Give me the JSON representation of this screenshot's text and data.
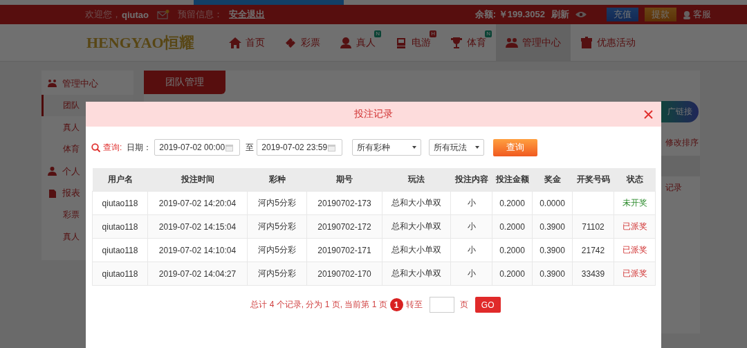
{
  "top_bar": {
    "welcome": "欢迎您，",
    "username": "qiutao",
    "reserved_label": "预留信息：",
    "logout": "安全退出",
    "balance": "余额: ￥199.3052",
    "refresh": "刷新",
    "deposit": "充值",
    "withdraw": "提款",
    "service": "客服"
  },
  "logo": "HENGYAO恒耀",
  "nav": [
    {
      "label": "首页",
      "selected": false
    },
    {
      "label": "彩票",
      "selected": false
    },
    {
      "label": "真人",
      "badge": "N",
      "selected": false
    },
    {
      "label": "电游",
      "badge": "H",
      "selected": false
    },
    {
      "label": "体育",
      "badge": "N",
      "selected": false
    },
    {
      "label": "管理中心",
      "selected": true
    },
    {
      "label": "优惠活动",
      "selected": false
    }
  ],
  "sidebar": [
    {
      "label": "管理中心",
      "kind": "header",
      "selected": false
    },
    {
      "label": "团队",
      "kind": "item",
      "selected": true
    },
    {
      "label": "真人",
      "kind": "item",
      "selected": false
    },
    {
      "label": "体育",
      "kind": "item",
      "selected": false
    },
    {
      "label": "个人",
      "kind": "header",
      "selected": false
    },
    {
      "label": "报表",
      "kind": "header",
      "selected": false
    },
    {
      "label": "彩票",
      "kind": "item",
      "selected": false
    },
    {
      "label": "真人",
      "kind": "item",
      "selected": false
    }
  ],
  "panel": {
    "tab": "团队管理",
    "promo_button": "广链接",
    "sort_link": "修改排序",
    "record_link": "记录"
  },
  "modal": {
    "title": "投注记录",
    "filter": {
      "query_label": "查询:",
      "date_label": "日期：",
      "date_from": "2019-07-02 00:00",
      "to_label": "至",
      "date_to": "2019-07-02 23:59",
      "lottery_select": "所有彩种",
      "play_select": "所有玩法",
      "search_button": "查询"
    },
    "table": {
      "columns": [
        "用户名",
        "投注时间",
        "彩种",
        "期号",
        "玩法",
        "投注内容",
        "投注金额",
        "奖金",
        "开奖号码",
        "状态"
      ],
      "rows": [
        {
          "cells": [
            "qiutao118",
            "2019-07-02 14:20:04",
            "河内5分彩",
            "20190702-173",
            "总和大小单双",
            "小",
            "0.2000",
            "0.0000",
            ""
          ],
          "status": "未开奖",
          "kind": "pending"
        },
        {
          "cells": [
            "qiutao118",
            "2019-07-02 14:15:04",
            "河内5分彩",
            "20190702-172",
            "总和大小单双",
            "小",
            "0.2000",
            "0.3900",
            "71102"
          ],
          "status": "已派奖",
          "kind": "paid"
        },
        {
          "cells": [
            "qiutao118",
            "2019-07-02 14:10:04",
            "河内5分彩",
            "20190702-171",
            "总和大小单双",
            "小",
            "0.2000",
            "0.3900",
            "21742"
          ],
          "status": "已派奖",
          "kind": "paid"
        },
        {
          "cells": [
            "qiutao118",
            "2019-07-02 14:04:27",
            "河内5分彩",
            "20190702-170",
            "总和大小单双",
            "小",
            "0.2000",
            "0.3900",
            "33439"
          ],
          "status": "已派奖",
          "kind": "paid"
        }
      ]
    },
    "pagination": {
      "summary": "总计 4 个记录, 分为 1 页, 当前第 1 页",
      "current_page": "1",
      "goto_label": "转至",
      "page_unit": "页",
      "go_button": "GO"
    }
  }
}
